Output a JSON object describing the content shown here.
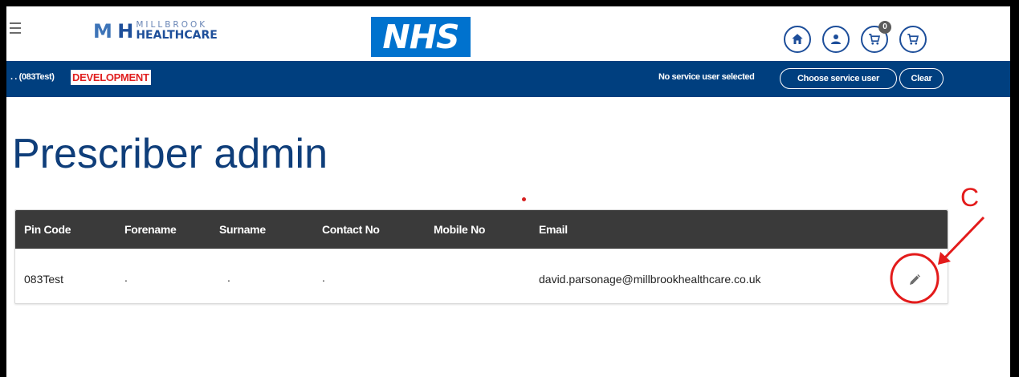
{
  "header": {
    "logo": {
      "mark": "MH",
      "line1": "MILLBROOK",
      "line2": "HEALTHCARE"
    },
    "nhs_logo": "NHS",
    "icons": [
      "menu-icon",
      "home-icon",
      "user-icon",
      "cart-icon",
      "cart-icon"
    ],
    "cart_count": "0"
  },
  "service_bar": {
    "user_code": ". . (083Test)",
    "environment": "DEVELOPMENT",
    "status": "No service user selected",
    "choose_label": "Choose service user",
    "clear_label": "Clear"
  },
  "page": {
    "title": "Prescriber admin"
  },
  "table": {
    "headers": [
      "Pin Code",
      "Forename",
      "Surname",
      "Contact No",
      "Mobile No",
      "Email"
    ],
    "rows": [
      {
        "pin": "083Test",
        "forename": ".",
        "surname": ".",
        "contact": ".",
        "mobile": "",
        "email": "david.parsonage@millbrookhealthcare.co.uk",
        "action_icon": "pencil-icon"
      }
    ]
  },
  "annotation": {
    "label": "C",
    "color": "#e31b1b"
  },
  "colors": {
    "brand_blue": "#003f7f",
    "nhs_blue": "#0072ce",
    "title_blue": "#0f3e7a",
    "header_dark": "#3a3a3a",
    "env_red": "#e02020"
  }
}
